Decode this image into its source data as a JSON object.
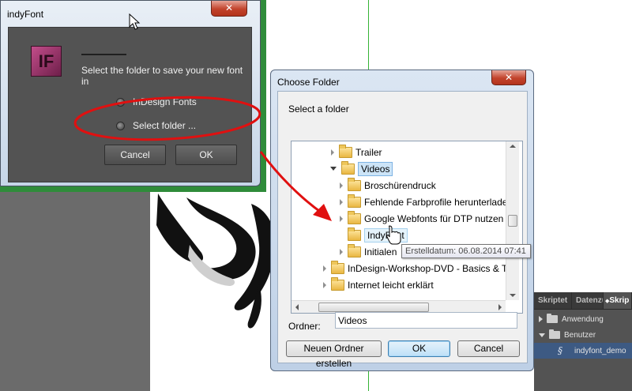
{
  "indyfont_dialog": {
    "title": "indyFont",
    "close_glyph": "✕",
    "logo_text": "IF",
    "prompt": "Select the folder to save your new font in",
    "options": [
      {
        "label": "InDesign Fonts",
        "selected": false
      },
      {
        "label": "Select folder ...",
        "selected": false
      }
    ],
    "cancel_label": "Cancel",
    "ok_label": "OK"
  },
  "choose_folder_dialog": {
    "title": "Choose Folder",
    "close_glyph": "✕",
    "select_label": "Select a folder",
    "tree": [
      {
        "label": "Trailer",
        "expander": "closed"
      },
      {
        "label": "Videos",
        "expander": "open",
        "state": "selected"
      },
      {
        "label": "Broschürendruck",
        "expander": "closed"
      },
      {
        "label": "Fehlende Farbprofile herunterlade",
        "expander": "closed"
      },
      {
        "label": "Google Webfonts für DTP nutzen",
        "expander": "closed"
      },
      {
        "label": "IndyFont",
        "expander": "none",
        "state": "hover"
      },
      {
        "label": "Initialen",
        "expander": "closed"
      },
      {
        "label": "InDesign-Workshop-DVD - Basics & T",
        "expander": "closed"
      },
      {
        "label": "Internet leicht erklärt",
        "expander": "closed"
      }
    ],
    "tooltip": "Erstelldatum: 06.08.2014 07:41",
    "ordner_label": "Ordner:",
    "ordner_value": "Videos",
    "new_folder_label": "Neuen Ordner erstellen",
    "ok_label": "OK",
    "cancel_label": "Cancel"
  },
  "indesign_panel": {
    "tabs": [
      {
        "label": "Skriptet",
        "active": false
      },
      {
        "label": "Datenzu",
        "active": false
      },
      {
        "label": "Skrip",
        "active": true
      }
    ],
    "tab_separator_glyph": "◆",
    "rows": [
      {
        "label": "Anwendung",
        "expander": "right"
      },
      {
        "label": "Benutzer",
        "expander": "down"
      },
      {
        "label": "indyfont_demo",
        "selected": true
      }
    ]
  },
  "annotation_colors": {
    "ellipse": "#e01010",
    "arrow": "#e01010",
    "dialog_highlight": "#2f8c3a",
    "guide": "#35b435"
  },
  "icons": [
    "close-icon",
    "app-logo-icon",
    "folder-icon",
    "expander-icon",
    "script-icon",
    "mouse-pointer-icon",
    "hand-pointer-icon"
  ]
}
